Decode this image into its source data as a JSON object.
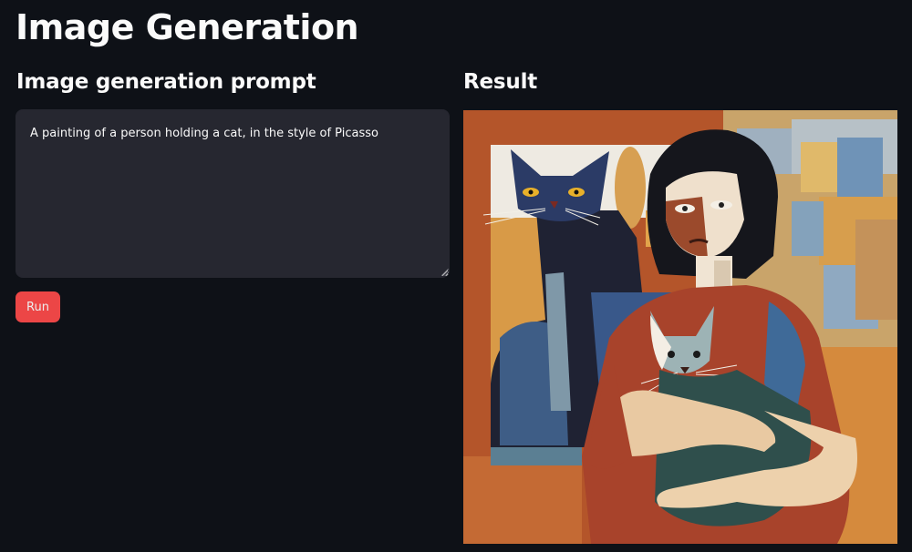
{
  "page": {
    "title": "Image Generation"
  },
  "prompt_section": {
    "heading": "Image generation prompt",
    "input_value": "A painting of a person holding a cat, in the style of Picasso",
    "run_label": "Run"
  },
  "result_section": {
    "heading": "Result",
    "image_alt": "Generated image"
  },
  "colors": {
    "background": "#0e1117",
    "input_background": "#262730",
    "button_primary": "#ff4b4b",
    "text": "#fafafa"
  }
}
